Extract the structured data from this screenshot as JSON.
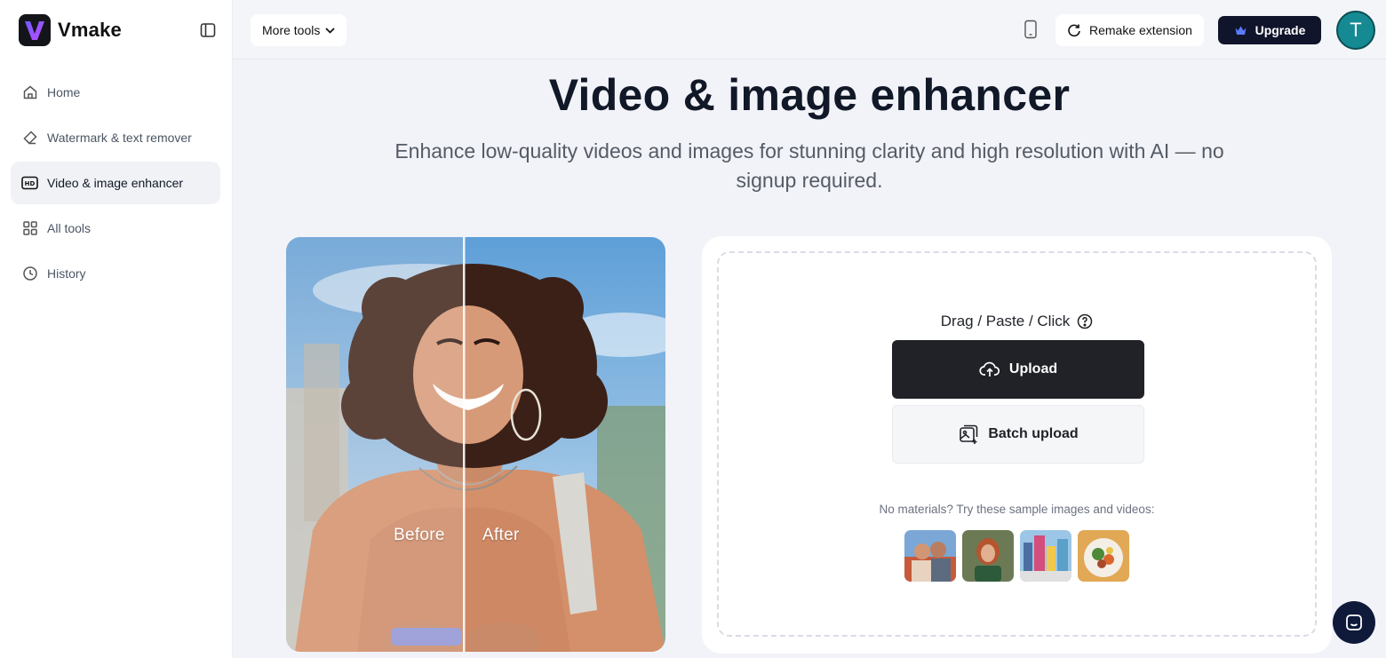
{
  "brand": {
    "name": "Vmake"
  },
  "sidebar": {
    "items": [
      {
        "label": "Home",
        "icon": "home-icon"
      },
      {
        "label": "Watermark & text remover",
        "icon": "eraser-icon"
      },
      {
        "label": "Video & image enhancer",
        "icon": "hd-icon",
        "active": true
      },
      {
        "label": "All tools",
        "icon": "grid-icon"
      },
      {
        "label": "History",
        "icon": "clock-icon"
      }
    ]
  },
  "topbar": {
    "more_tools": "More tools",
    "remake_extension": "Remake extension",
    "upgrade": "Upgrade",
    "avatar_initial": "T"
  },
  "hero": {
    "title": "Video & image enhancer",
    "subtitle": "Enhance low-quality videos and images for stunning clarity and high resolution with AI — no signup required."
  },
  "preview": {
    "before": "Before",
    "after": "After"
  },
  "upload": {
    "hint": "Drag / Paste / Click",
    "upload_label": "Upload",
    "batch_label": "Batch upload",
    "samples_hint": "No materials? Try these sample images and videos:"
  },
  "colors": {
    "accent": "#202227",
    "upgrade": "#10152b",
    "avatar": "#168a93",
    "chat": "#0f1a3a"
  }
}
